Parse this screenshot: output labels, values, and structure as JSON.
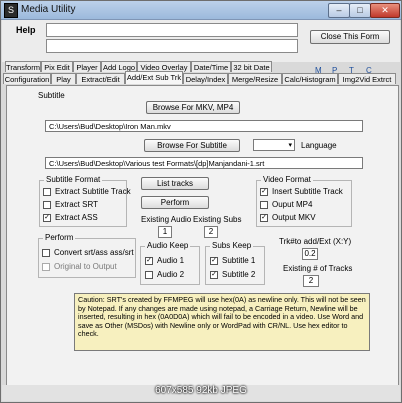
{
  "window": {
    "title": "Media Utility",
    "minimize": "–",
    "maximize": "□",
    "close": "✕"
  },
  "menu": {
    "help": "Help",
    "close_form": "Close This Form",
    "mptc": [
      "M",
      "P",
      "T",
      "C"
    ]
  },
  "tabs_row1": [
    "Transform",
    "Pix Edit",
    "Player",
    "Add Logo",
    "Video Overlay",
    "Date/Time",
    "32 bit Date"
  ],
  "tabs_row2": [
    "Configuration",
    "Play",
    "Extract/Edit",
    "Add/Ext Sub Trk",
    "Delay/Index",
    "Merge/Resize",
    "Calc/Histogram",
    "Img2Vid Extrct"
  ],
  "active_tab_index": 3,
  "subtitle": {
    "group_label": "Subtitle",
    "browse_mkv": "Browse For MKV, MP4",
    "mkv_path": "C:\\Users\\Bud\\Desktop\\Iron Man.mkv",
    "browse_subtitle": "Browse For Subtitle",
    "language_label": "Language",
    "language_value": "",
    "sub_path": "C:\\Users\\Bud\\Desktop\\Various test Formats\\[dp]Manjandani-1.srt"
  },
  "subtitle_format": {
    "label": "Subtitle Format",
    "options": [
      {
        "label": "Extract Subtitle Track",
        "checked": false
      },
      {
        "label": "Extract SRT",
        "checked": false
      },
      {
        "label": "Extract ASS",
        "checked": true
      }
    ]
  },
  "buttons": {
    "list_tracks": "List tracks",
    "perform": "Perform"
  },
  "video_format": {
    "label": "Video Format",
    "options": [
      {
        "label": "Insert Subtitle Track",
        "checked": true
      },
      {
        "label": "Ouput MP4",
        "checked": false
      },
      {
        "label": "Output MKV",
        "checked": true
      }
    ]
  },
  "existing_audio": {
    "label": "Existing Audio",
    "value": "1"
  },
  "existing_subs": {
    "label": "Existing Subs",
    "value": "2"
  },
  "perform_group": {
    "label": "Perform",
    "options": [
      {
        "label": "Convert srt/ass ass/srt",
        "checked": false
      },
      {
        "label": "Original to Output",
        "checked": false
      }
    ]
  },
  "audio_keep": {
    "label": "Audio Keep",
    "options": [
      {
        "label": "Audio 1",
        "checked": true
      },
      {
        "label": "Audio 2",
        "checked": false
      }
    ]
  },
  "subs_keep": {
    "label": "Subs Keep",
    "options": [
      {
        "label": "Subtitle 1",
        "checked": true
      },
      {
        "label": "Subtitle 2",
        "checked": true
      }
    ]
  },
  "trk_add": {
    "label": "Trk#to add/Ext (X:Y)",
    "value": "0.2"
  },
  "existing_tracks": {
    "label": "Existing # of Tracks",
    "value": "2"
  },
  "caution": "Caution: SRT's created by FFMPEG will use hex(0A) as newline only.  This will not be seen by Notepad.  If any changes are made using notepad, a Carriage Return, Newline will be inserted, resulting in hex (0A0D0A) which will fail to be encoded in a video. Use Word and save as Other (MSDos) with Newline only or WordPad with CR/NL. Use hex editor to check.",
  "footer": "607x585 92kb JPEG",
  "colors": {
    "title_bg": "#a9c3e3",
    "caution_bg": "#f7f0bf",
    "mptc": "#1f4f9c"
  }
}
